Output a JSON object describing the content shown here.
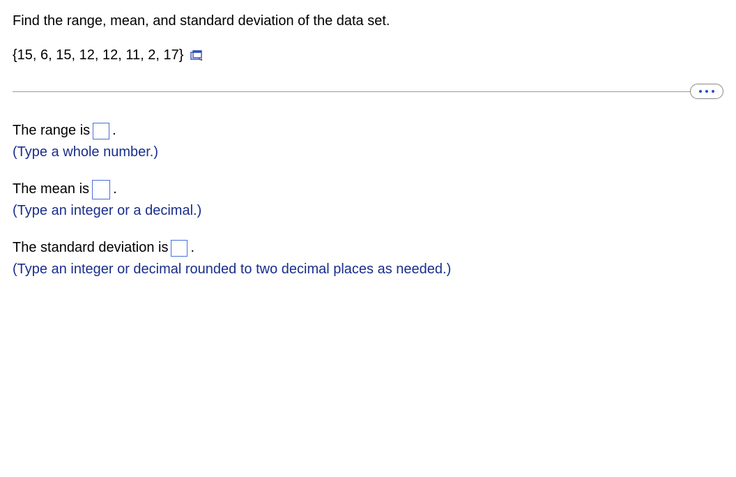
{
  "question": {
    "prompt": "Find the range, mean, and standard deviation of the data set.",
    "data_set": "{15, 6, 15, 12, 12, 11, 2, 17}"
  },
  "answers": {
    "range": {
      "prefix": "The range is",
      "suffix": ".",
      "value": "",
      "hint": "(Type a whole number.)"
    },
    "mean": {
      "prefix": "The mean is",
      "suffix": ".",
      "value": "",
      "hint": "(Type an integer or a decimal.)"
    },
    "stddev": {
      "prefix": "The standard deviation is",
      "suffix": ".",
      "value": "",
      "hint": "(Type an integer or decimal rounded to two decimal places as needed.)"
    }
  }
}
